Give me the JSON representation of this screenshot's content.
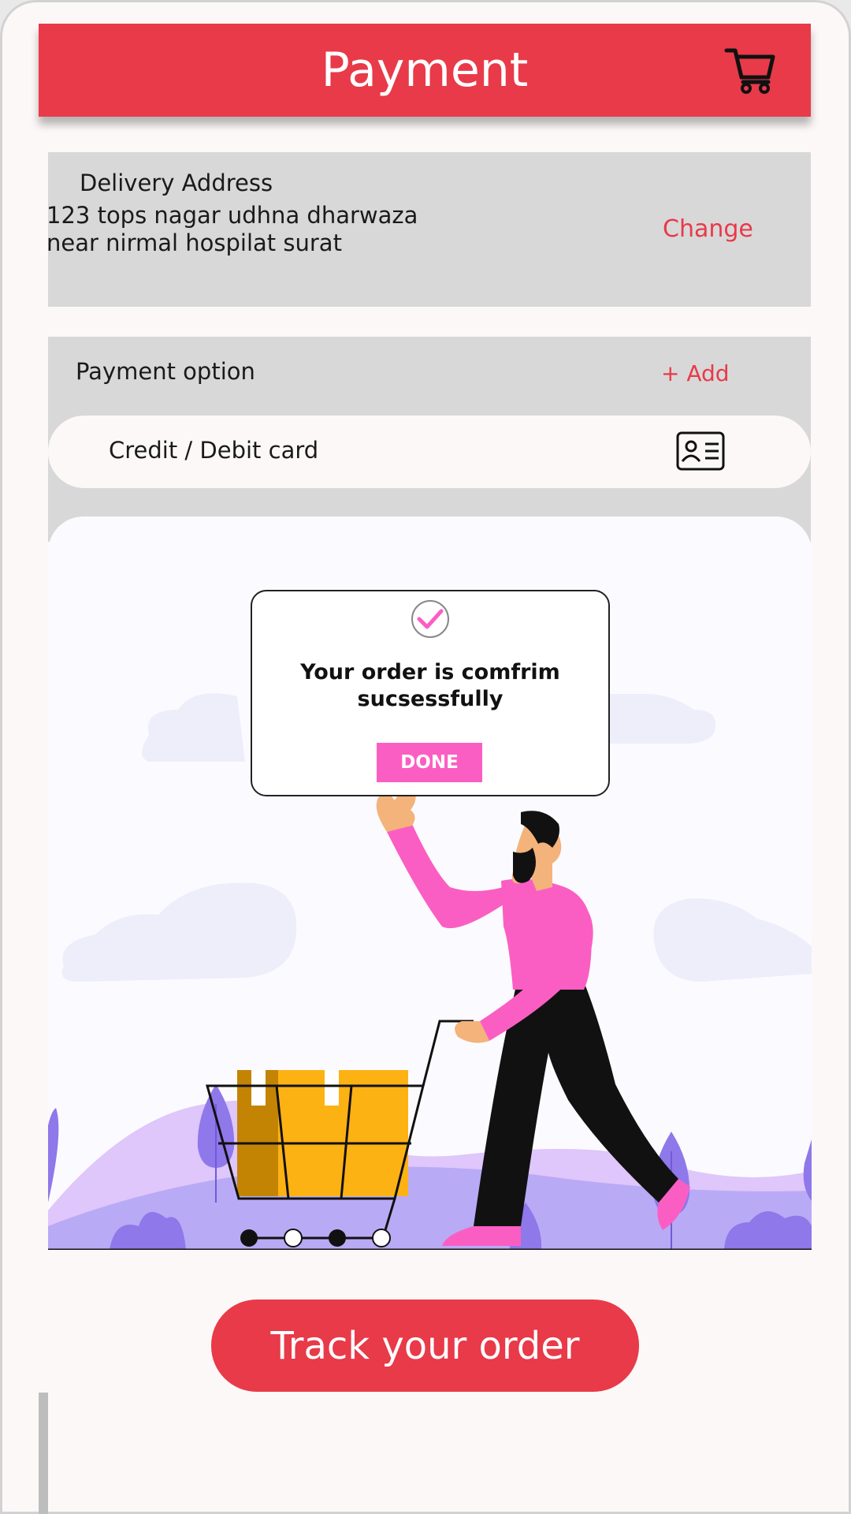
{
  "header": {
    "title": "Payment",
    "cart_icon": "cart-icon"
  },
  "address": {
    "title": "Delivery Address",
    "line1": "123  tops nagar udhna dharwaza",
    "line2": "near nirmal hospilat surat",
    "change_label": "Change"
  },
  "payment": {
    "title": "Payment option",
    "add_label": "+ Add",
    "option_label": "Credit / Debit card",
    "option_icon": "id-card-icon"
  },
  "popup": {
    "message_line1": "Your order is comfrim",
    "message_line2": "sucsessfully",
    "done_label": "DONE",
    "check_icon": "check-circle-icon"
  },
  "track_button": {
    "label": "Track your order"
  },
  "colors": {
    "accent": "#e83a49",
    "pink": "#fb5ec3",
    "card_bg": "#d8d8d8",
    "page_bg": "#fcf8f8",
    "lavender": "#b9aaf5",
    "purple": "#8e78ea",
    "box_yellow": "#fdb214"
  }
}
